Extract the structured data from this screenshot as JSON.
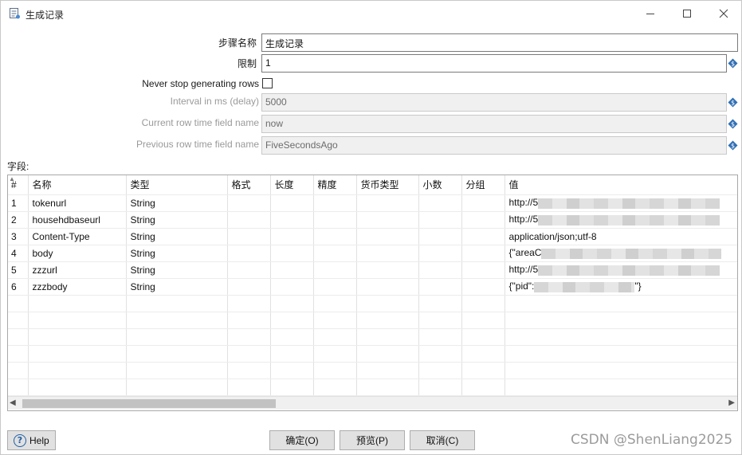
{
  "window": {
    "title": "生成记录",
    "icon": "document-list-icon",
    "controls": {
      "minimize": "minimize-icon",
      "maximize": "maximize-icon",
      "close": "close-icon"
    }
  },
  "form": {
    "step_name": {
      "label": "步骤名称",
      "value": "生成记录"
    },
    "limit": {
      "label": "限制",
      "value": "1"
    },
    "never_stop": {
      "label": "Never stop generating rows",
      "checked": false
    },
    "interval": {
      "label": "Interval in ms (delay)",
      "value": "5000"
    },
    "current_time_field": {
      "label": "Current row time field name",
      "value": "now"
    },
    "previous_time_field": {
      "label": "Previous row time field name",
      "value": "FiveSecondsAgo"
    }
  },
  "fields_section": {
    "label": "字段:"
  },
  "table": {
    "columns": [
      "#",
      "名称",
      "类型",
      "格式",
      "长度",
      "精度",
      "货币类型",
      "小数",
      "分组",
      "值"
    ],
    "rows": [
      {
        "num": "1",
        "name": "tokenurl",
        "type": "String",
        "value": "http://5"
      },
      {
        "num": "2",
        "name": "househdbaseurl",
        "type": "String",
        "value": "http://5"
      },
      {
        "num": "3",
        "name": "Content-Type",
        "type": "String",
        "value": "application/json;utf-8"
      },
      {
        "num": "4",
        "name": "body",
        "type": "String",
        "value": "{\"areaC"
      },
      {
        "num": "5",
        "name": "zzzurl",
        "type": "String",
        "value": "http://5"
      },
      {
        "num": "6",
        "name": "zzzbody",
        "type": "String",
        "value": "{\"pid\":",
        "value_end": "\"}"
      }
    ]
  },
  "buttons": {
    "help": "Help",
    "ok": "确定(O)",
    "preview": "预览(P)",
    "cancel": "取消(C)"
  },
  "watermark": "CSDN @ShenLiang2025",
  "colors": {
    "variable_icon": "#2f6fb5",
    "disabled_field": "#f0f0f0"
  }
}
